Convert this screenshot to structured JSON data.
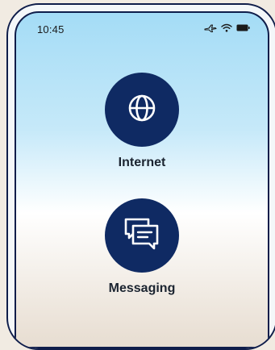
{
  "status_bar": {
    "time": "10:45",
    "icons": [
      "airplane-icon",
      "wifi-icon",
      "battery-icon"
    ]
  },
  "apps": [
    {
      "label": "Internet",
      "icon": "globe-icon"
    },
    {
      "label": "Messaging",
      "icon": "chat-bubbles-icon"
    }
  ],
  "colors": {
    "icon_background": "#0f2a63",
    "device_outline": "#0f1d4a",
    "label_text": "#1b2430"
  }
}
